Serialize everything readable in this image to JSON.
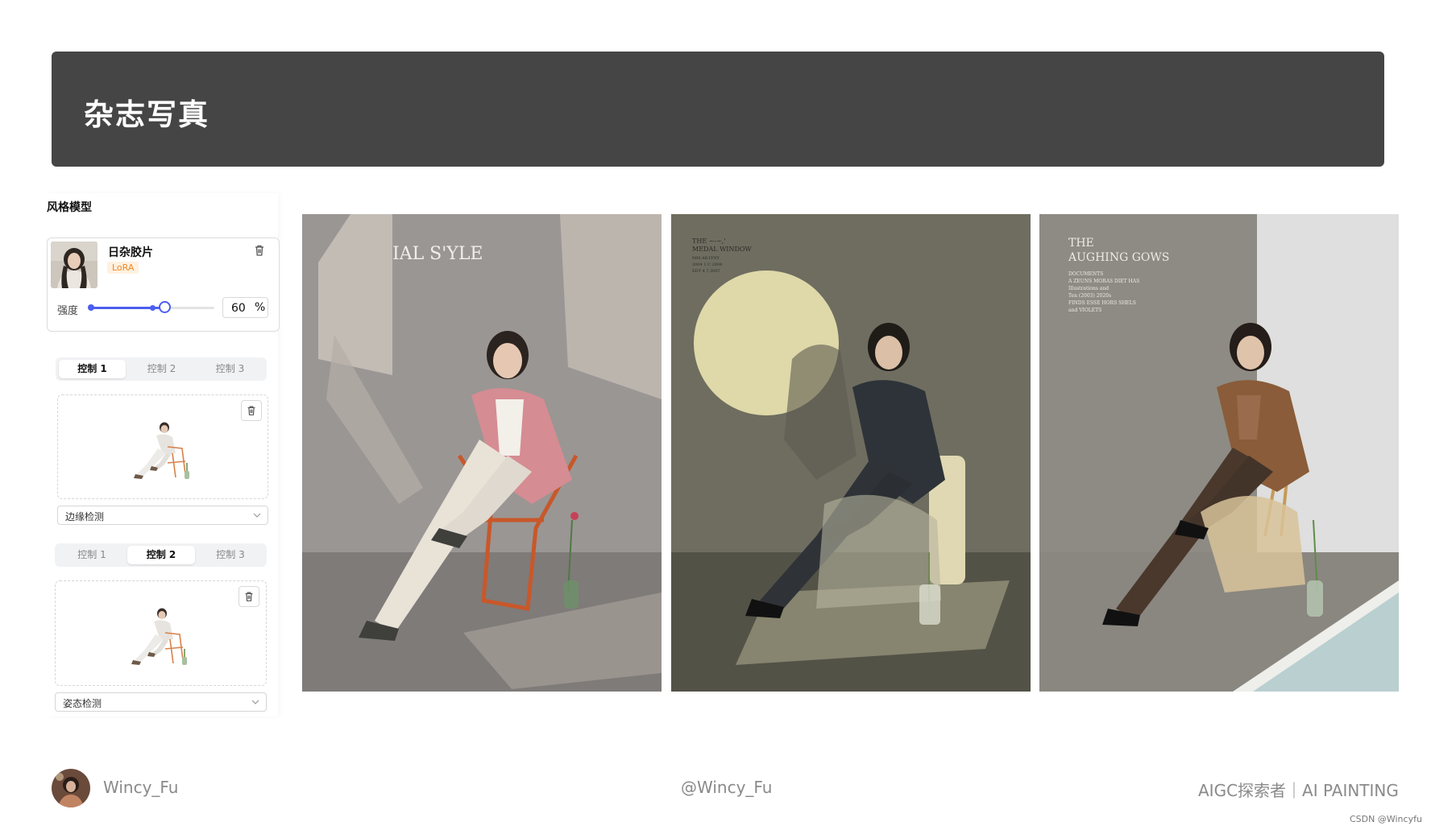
{
  "banner": {
    "title": "杂志写真"
  },
  "sidebar": {
    "section_label": "风格模型",
    "model": {
      "name": "日杂胶片",
      "badge": "LoRA",
      "strength_label": "强度",
      "strength_value": "60",
      "strength_unit": "%",
      "strength_fraction": 0.6
    },
    "control_groups": [
      {
        "tabs": [
          "控制 1",
          "控制 2",
          "控制 3"
        ],
        "active_tab": 0,
        "preprocessor": "边缘检测"
      },
      {
        "tabs": [
          "控制 1",
          "控制 2",
          "控制 3"
        ],
        "active_tab": 1,
        "preprocessor": "姿态检测"
      }
    ]
  },
  "gallery": {
    "photos": [
      {
        "caption": "IAL S'YLE"
      },
      {
        "caption_lines": [
          "THE ~-~,'  ",
          "MEDAL WINDOW",
          "MM AR ITNY",
          "2004 1 C 2004",
          "EDT 4 7,3007"
        ]
      },
      {
        "caption_lines": [
          "THE",
          "AUGHING GOWS"
        ],
        "small_lines": [
          "DOCUMENTS",
          "A ZEUNS MORAS DIET HAS",
          "Illustrations and",
          "Ten (2003) 2020s",
          "FINDS ESSE HORS SHELS",
          "and VIOLETS"
        ]
      }
    ]
  },
  "footer": {
    "author": "Wincy_Fu",
    "handle": "@Wincy_Fu",
    "tagline": "AIGC探索者｜AI PAINTING",
    "watermark": "CSDN @Wincyfu"
  },
  "icons": {
    "trash": "trash-icon",
    "chevron": "chevron-down-icon"
  },
  "colors": {
    "accent": "#4b5ef0",
    "banner": "#454545",
    "badge": "#f08a24"
  }
}
